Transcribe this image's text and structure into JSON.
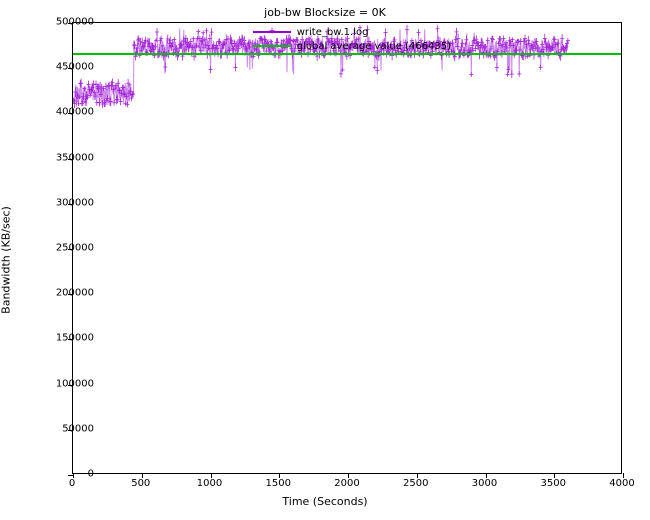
{
  "chart_data": {
    "type": "line",
    "title": "job-bw Blocksize = 0K",
    "xlabel": "Time (Seconds)",
    "ylabel": "Bandwidth (KB/sec)",
    "xlim": [
      0,
      4000
    ],
    "ylim": [
      0,
      500000
    ],
    "x_ticks": [
      0,
      500,
      1000,
      1500,
      2000,
      2500,
      3000,
      3500,
      4000
    ],
    "y_ticks": [
      0,
      50000,
      100000,
      150000,
      200000,
      250000,
      300000,
      350000,
      400000,
      450000,
      500000
    ],
    "global_average": 466435,
    "series": [
      {
        "name": "write_bw.1.log",
        "color": "#9400D3",
        "style": "line-with-plus-markers",
        "x_range": [
          5,
          3600
        ],
        "segments": [
          {
            "x_from": 5,
            "x_to": 440,
            "mean": 421000,
            "noise": 13000,
            "spike_low": 400000,
            "spike_high": 440000
          },
          {
            "x_from": 440,
            "x_to": 3600,
            "mean": 473000,
            "noise": 10000,
            "spike_low": 442000,
            "spike_high": 495000
          }
        ],
        "notable_dips": [
          {
            "x": 475,
            "y": 415000
          },
          {
            "x": 2160,
            "y": 418000
          }
        ]
      },
      {
        "name": "global average value (466435)",
        "color": "#00C000",
        "style": "hline",
        "y": 466435
      }
    ]
  },
  "colors": {
    "series1": "#9400D3",
    "avg": "#00C000",
    "axis": "#000000"
  },
  "title": "job-bw Blocksize = 0K",
  "xlabel": "Time (Seconds)",
  "ylabel": "Bandwidth (KB/sec)",
  "legend": {
    "row1_label": "write_bw.1.log",
    "row2_label": "global average value (466435)"
  },
  "y_tick_labels": [
    "0",
    "50000",
    "100000",
    "150000",
    "200000",
    "250000",
    "300000",
    "350000",
    "400000",
    "450000",
    "500000"
  ],
  "x_tick_labels": [
    "0",
    "500",
    "1000",
    "1500",
    "2000",
    "2500",
    "3000",
    "3500",
    "4000"
  ]
}
